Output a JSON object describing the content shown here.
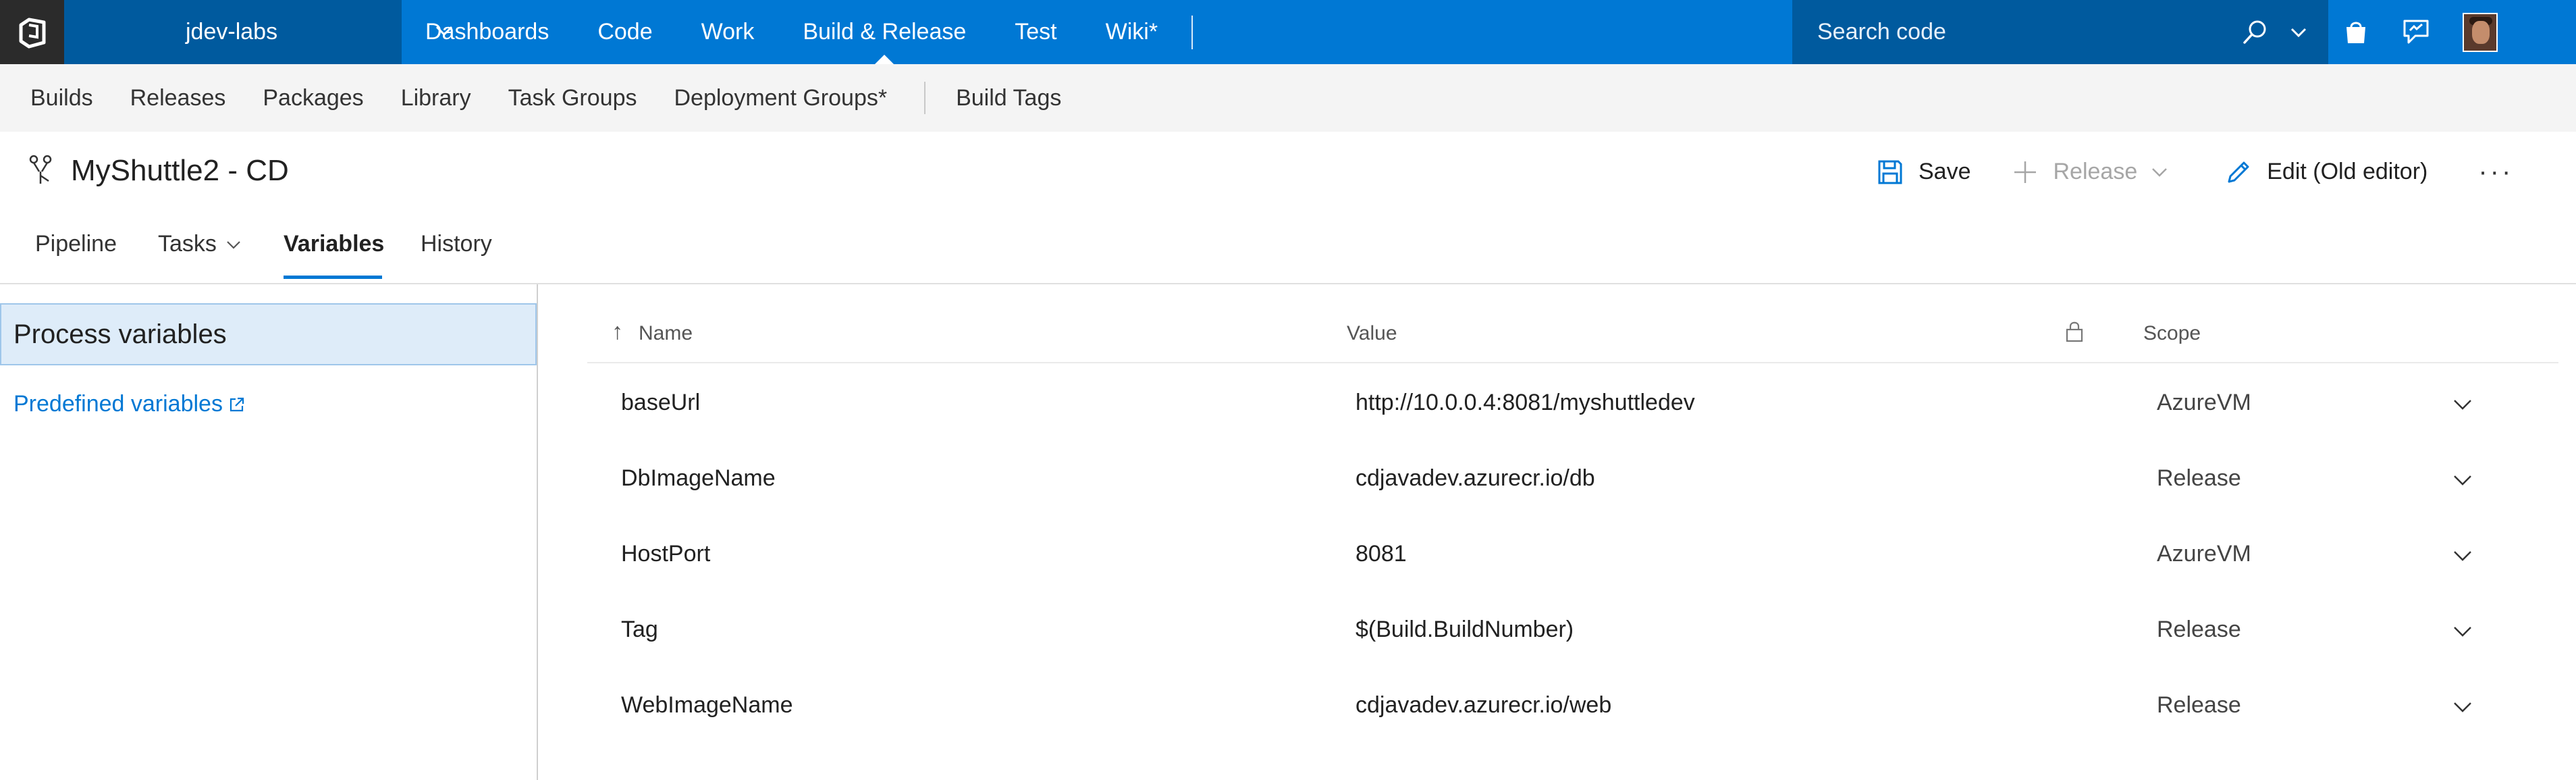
{
  "topbar": {
    "project": "jdev-labs",
    "nav": [
      "Dashboards",
      "Code",
      "Work",
      "Build & Release",
      "Test",
      "Wiki*"
    ],
    "active_nav": "Build & Release",
    "search_placeholder": "Search code"
  },
  "subnav": {
    "items": [
      "Builds",
      "Releases",
      "Packages",
      "Library",
      "Task Groups",
      "Deployment Groups*"
    ],
    "extra": "Build Tags"
  },
  "titlebar": {
    "title": "MyShuttle2 - CD",
    "save": "Save",
    "release": "Release",
    "edit": "Edit (Old editor)",
    "more": "···"
  },
  "tabs": {
    "pipeline": "Pipeline",
    "tasks": "Tasks",
    "variables": "Variables",
    "history": "History"
  },
  "left": {
    "process_variables": "Process variables",
    "predefined": "Predefined variables"
  },
  "grid": {
    "headers": {
      "name": "Name",
      "value": "Value",
      "scope": "Scope"
    },
    "sort_indicator": "↑",
    "rows": [
      {
        "name": "baseUrl",
        "value": "http://10.0.0.4:8081/myshuttledev",
        "scope": "AzureVM"
      },
      {
        "name": "DbImageName",
        "value": "cdjavadev.azurecr.io/db",
        "scope": "Release"
      },
      {
        "name": "HostPort",
        "value": "8081",
        "scope": "AzureVM"
      },
      {
        "name": "Tag",
        "value": "$(Build.BuildNumber)",
        "scope": "Release"
      },
      {
        "name": "WebImageName",
        "value": "cdjavadev.azurecr.io/web",
        "scope": "Release"
      }
    ]
  },
  "colors": {
    "accent": "#0078d4",
    "project_bg": "#005a9e",
    "selected_bg": "#deecf9"
  }
}
